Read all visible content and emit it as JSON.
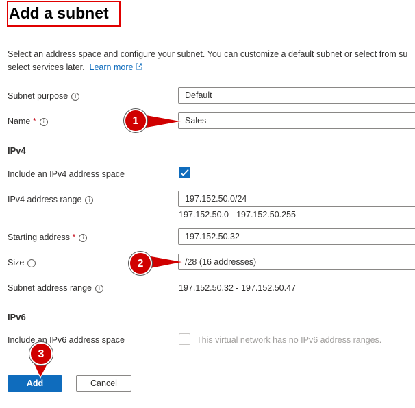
{
  "header": {
    "title": "Add a subnet"
  },
  "description": {
    "text": "Select an address space and configure your subnet. You can customize a default subnet or select from subnet templates and add select services later.",
    "line1": "Select an address space and configure your subnet. You can customize a default subnet or select from su",
    "line2": "select services later.",
    "learn_more": "Learn more"
  },
  "form": {
    "subnet_purpose": {
      "label": "Subnet purpose",
      "value": "Default"
    },
    "name": {
      "label": "Name",
      "required_mark": "*",
      "value": "Sales"
    },
    "ipv4": {
      "section": "IPv4",
      "include_label": "Include an IPv4 address space",
      "include_checked": true,
      "range_label": "IPv4 address range",
      "range_value": "197.152.50.0/24",
      "range_hint": "197.152.50.0 - 197.152.50.255",
      "starting_label": "Starting address",
      "starting_required": "*",
      "starting_value": "197.152.50.32",
      "size_label": "Size",
      "size_value": "/28 (16 addresses)",
      "subnet_range_label": "Subnet address range",
      "subnet_range_value": "197.152.50.32 - 197.152.50.47"
    },
    "ipv6": {
      "section": "IPv6",
      "include_label": "Include an IPv6 address space",
      "include_checked": false,
      "disabled_text": "This virtual network has no IPv6 address ranges."
    }
  },
  "footer": {
    "add_label": "Add",
    "cancel_label": "Cancel"
  },
  "annotations": {
    "badge1": "1",
    "badge2": "2",
    "badge3": "3",
    "color": "#d00000"
  },
  "icons": {
    "info": "i"
  },
  "colors": {
    "accent": "#0f6cbd",
    "required": "#c50f1f",
    "highlight": "#e00000"
  }
}
